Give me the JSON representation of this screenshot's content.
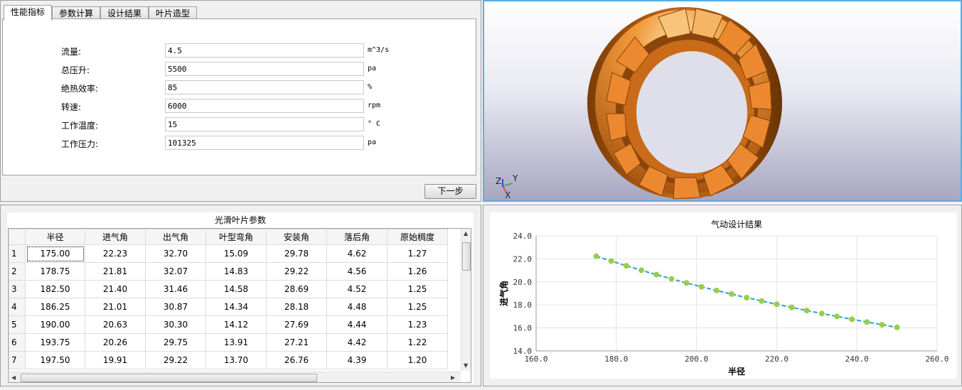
{
  "tabs": [
    {
      "label": "性能指标",
      "active": true
    },
    {
      "label": "参数计算",
      "active": false
    },
    {
      "label": "设计结果",
      "active": false
    },
    {
      "label": "叶片造型",
      "active": false
    }
  ],
  "form": {
    "fields": [
      {
        "label": "流量:",
        "value": "4.5",
        "unit": "m^3/s"
      },
      {
        "label": "总压升:",
        "value": "5500",
        "unit": "pa"
      },
      {
        "label": "绝热效率:",
        "value": "85",
        "unit": "%"
      },
      {
        "label": "转速:",
        "value": "6000",
        "unit": "rpm"
      },
      {
        "label": "工作温度:",
        "value": "15",
        "unit": "° C"
      },
      {
        "label": "工作压力:",
        "value": "101325",
        "unit": "pa"
      }
    ],
    "next_button": "下一步"
  },
  "view3d": {
    "axes": {
      "z": "Z",
      "y": "Y",
      "x": "X"
    },
    "background": "#d8d8e6",
    "blade_color": "#e07a1f"
  },
  "table": {
    "title": "光滑叶片参数",
    "headers": [
      "半径",
      "进气角",
      "出气角",
      "叶型弯角",
      "安装角",
      "落后角",
      "原始稠度"
    ],
    "rows": [
      {
        "index": "1",
        "cells": [
          "175.00",
          "22.23",
          "32.70",
          "15.09",
          "29.78",
          "4.62",
          "1.27"
        ]
      },
      {
        "index": "2",
        "cells": [
          "178.75",
          "21.81",
          "32.07",
          "14.83",
          "29.22",
          "4.56",
          "1.26"
        ]
      },
      {
        "index": "3",
        "cells": [
          "182.50",
          "21.40",
          "31.46",
          "14.58",
          "28.69",
          "4.52",
          "1.25"
        ]
      },
      {
        "index": "4",
        "cells": [
          "186.25",
          "21.01",
          "30.87",
          "14.34",
          "28.18",
          "4.48",
          "1.25"
        ]
      },
      {
        "index": "5",
        "cells": [
          "190.00",
          "20.63",
          "30.30",
          "14.12",
          "27.69",
          "4.44",
          "1.23"
        ]
      },
      {
        "index": "6",
        "cells": [
          "193.75",
          "20.26",
          "29.75",
          "13.91",
          "27.21",
          "4.42",
          "1.22"
        ]
      },
      {
        "index": "7",
        "cells": [
          "197.50",
          "19.91",
          "29.22",
          "13.70",
          "26.76",
          "4.39",
          "1.20"
        ]
      }
    ]
  },
  "chart_data": {
    "type": "line",
    "title": "气动设计结果",
    "xlabel": "半径",
    "ylabel": "进气角",
    "xlim": [
      160,
      260
    ],
    "ylim": [
      14,
      24
    ],
    "xticks": [
      "160.0",
      "180.0",
      "200.0",
      "220.0",
      "240.0",
      "260.0"
    ],
    "yticks": [
      "14.0",
      "16.0",
      "18.0",
      "20.0",
      "22.0",
      "24.0"
    ],
    "grid": true,
    "line_color": "#2a9fd6",
    "marker_color": "#9acd4a",
    "x": [
      175.0,
      178.75,
      182.5,
      186.25,
      190.0,
      193.75,
      197.5,
      201.25,
      205.0,
      208.75,
      212.5,
      216.25,
      220.0,
      223.75,
      227.5,
      231.25,
      235.0,
      238.75,
      242.5,
      246.25,
      250.0
    ],
    "y": [
      22.23,
      21.81,
      21.4,
      21.01,
      20.63,
      20.26,
      19.91,
      19.57,
      19.25,
      18.94,
      18.63,
      18.34,
      18.06,
      17.78,
      17.51,
      17.25,
      17.0,
      16.75,
      16.51,
      16.28,
      16.05
    ]
  }
}
